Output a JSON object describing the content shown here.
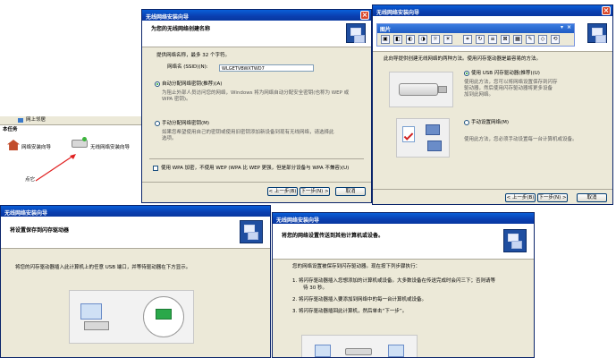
{
  "window1": {
    "title": "无线网络安装向导",
    "header_title": "为您的无线网络创建名称",
    "intro": "提供网络名称，最多 32 个字符。",
    "ssid_label": "网络名 (SSID)(N):",
    "ssid_value": "WLGETVBWXTWD7",
    "opt_auto_label": "自动分配网络密钥(推荐)(A)",
    "opt_auto_desc_1": "为阻止外部人员访问您的网络，Windows 将为网络自动分配安全密钥(也称为 WEP 或",
    "opt_auto_desc_2": "WPA 密钥)。",
    "opt_manual_label": "手动分配网络密钥(M)",
    "opt_manual_desc_1": "如果您希望使用自己的密钥或使用旧密钥添加新设备到现有无线网络，请选择此",
    "opt_manual_desc_2": "选项。",
    "wpa_label": "使用 WPA 加密，不使用 WEP (WPA 比 WEP 更强，但是部分设备与 WPA 不兼容)(U)",
    "back": "< 上一步(B)",
    "next": "下一步(N) >",
    "cancel": "取消"
  },
  "window2": {
    "title": "无线网络安装向导",
    "toolbar_title": "图片",
    "intro": "此向导提供创建无线网络的两种方法。使用闪存驱动器是最容易的方法。",
    "opt_usb_label": "使用 USB 闪存驱动器(推荐)(U)",
    "opt_usb_desc_1": "使用此方法，您可以将网络设置保存到闪存",
    "opt_usb_desc_2": "驱动器，然后使用闪存驱动器将更多设备",
    "opt_usb_desc_3": "加到此网络。",
    "opt_manual_label": "手动设置网络(M)",
    "opt_manual_desc_1": "使用此方法，您必须手动设置每一台计算机或设备。",
    "back": "< 上一步(B)",
    "next": "下一步(N) >",
    "cancel": "取消"
  },
  "background": {
    "address_label": "网上邻居",
    "task_label": "本任务",
    "desktop_item": "网络安装向导",
    "wizard_item": "无线网络安装向导",
    "click_note": "点它"
  },
  "window3": {
    "title": "无线网络安装向导",
    "header_title": "将设置保存到闪存驱动器",
    "body": "将您的闪存驱动器插入此计算机上的任意 USB 端口，并等待驱动器在下方显示。"
  },
  "window4": {
    "title": "无线网络安装向导",
    "header_title": "将您的网络设置传送到其他计算机或设备。",
    "intro": "您的网络设置被保存到闪存驱动器。现在按下列步骤执行：",
    "step1_a": "1.   将闪存驱动器插入您想添加的计算机或设备。大多数设备在传送完成时会闪三下；否则请等",
    "step1_b": "待 30 秒。",
    "step2": "2.   将闪存驱动器插入要添加到网络中的每一台计算机或设备。",
    "step3": "3.   将闪存驱动器插回此计算机，然后单击“下一步”。"
  }
}
